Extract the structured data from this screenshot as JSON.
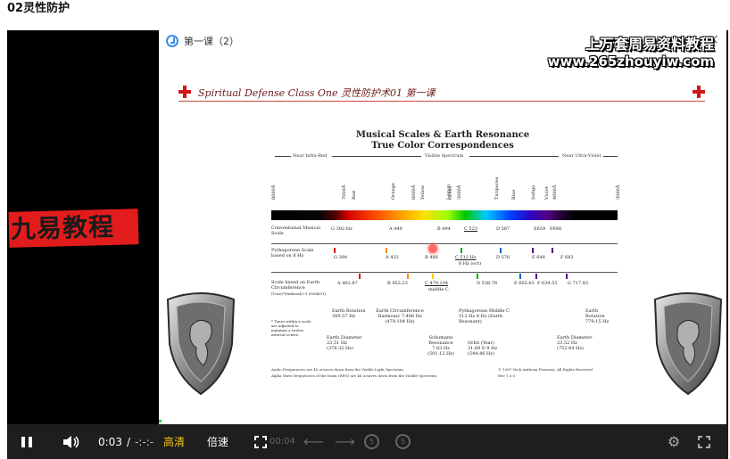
{
  "page_title": "02灵性防护",
  "side_brand": "九易教程",
  "window": {
    "title": "第一课（2）"
  },
  "watermark": {
    "line1": "上万套周易资料教程",
    "line2": "www.265zhouyiw.com"
  },
  "slide": {
    "header": "Spiritual Defense Class One 灵性防护术01 第一课",
    "title_line1": "Musical Scales & Earth Resonance",
    "title_line2": "True Color Correspondences",
    "spectrum_sections": [
      "Near Infra-Red",
      "Visible Spectrum",
      "Near Ultra-Violet"
    ],
    "wavelength_labels": [
      "8000Å",
      "7000Å",
      "Red",
      "Orange",
      "6000Å",
      "Yellow",
      "Lemon",
      "Green",
      "5000Å",
      "Turquoise",
      "Blue",
      "Indigo",
      "Violet",
      "4000Å",
      "3000Å"
    ],
    "rows": [
      {
        "label": "Conventional Musical Scale",
        "notes": [
          "G 392 Hz",
          "A 440",
          "B 494",
          "C 523",
          "D 587",
          "E659",
          "F698"
        ]
      },
      {
        "label": "Pythagorean Scale based on 8 Hz",
        "notes": [
          "G 384",
          "A 432",
          "B 486",
          "C 512 Hz",
          "8 Hz (oct)",
          "D 576",
          "E 648",
          "F 683"
        ]
      },
      {
        "label": "Scale based on Earth Circumference",
        "sublabel": "(True)*(Sidereal)+1.5594831)",
        "notes": [
          "A 402.87",
          "B 453.23",
          "C 479.104",
          "middle C",
          "D 538.78",
          "E 605.63",
          "F 639.53",
          "G 717.83"
        ]
      }
    ],
    "annotations": [
      "Earth Rotation 389.57 Hz",
      "Earth Circumference Harmonic 7.486 Hz (479.104 Hz)",
      "Pythagorean Middle C 512 Hz 8 Hz (Earth Resonant)",
      "Earth Rotation 779.15 Hz",
      "Earth Diameter 23.51 Hz (376.32 Hz)",
      "Schumann Resonance 7.83 Hz (501.12 Hz)",
      "Orbit (Year) 31.69 E-9 Hz (544.46 Hz)",
      "Earth Diameter 23.52 Hz (752.64 Hz)",
      "* Tones within a scale are adjusted to maintain a twelve interval octave."
    ],
    "footnotes": [
      "Audio Frequencies are 40 octaves down from the Visible Light Spectrum.",
      "Alpha Wave frequencies of the brain (EEG) are 46 octaves down from the Visible Spectrum.",
      "© 1987 Nick Anthony Fiorenza, All Rights Reserved",
      "Rev 1.0.0"
    ]
  },
  "controls": {
    "current_time": "0:03",
    "separator": "/",
    "total_time": "-:-:-",
    "quality_label": "高清",
    "speed_label": "倍速",
    "dim_time": "00:04",
    "rewind_label": "5",
    "forward_label": "5"
  },
  "progress": {
    "played_fraction": 0.004
  },
  "colors": {
    "quality_accent": "#f5c518",
    "brand_red": "#e21c1c",
    "progress_green": "#2ecc40"
  },
  "icons": [
    "pause-icon",
    "volume-icon",
    "fullscreen-icon",
    "rewind-icon",
    "forward-icon",
    "settings-icon",
    "check-circle-icon",
    "close-icon",
    "red-cross-icon",
    "shield-icon"
  ]
}
